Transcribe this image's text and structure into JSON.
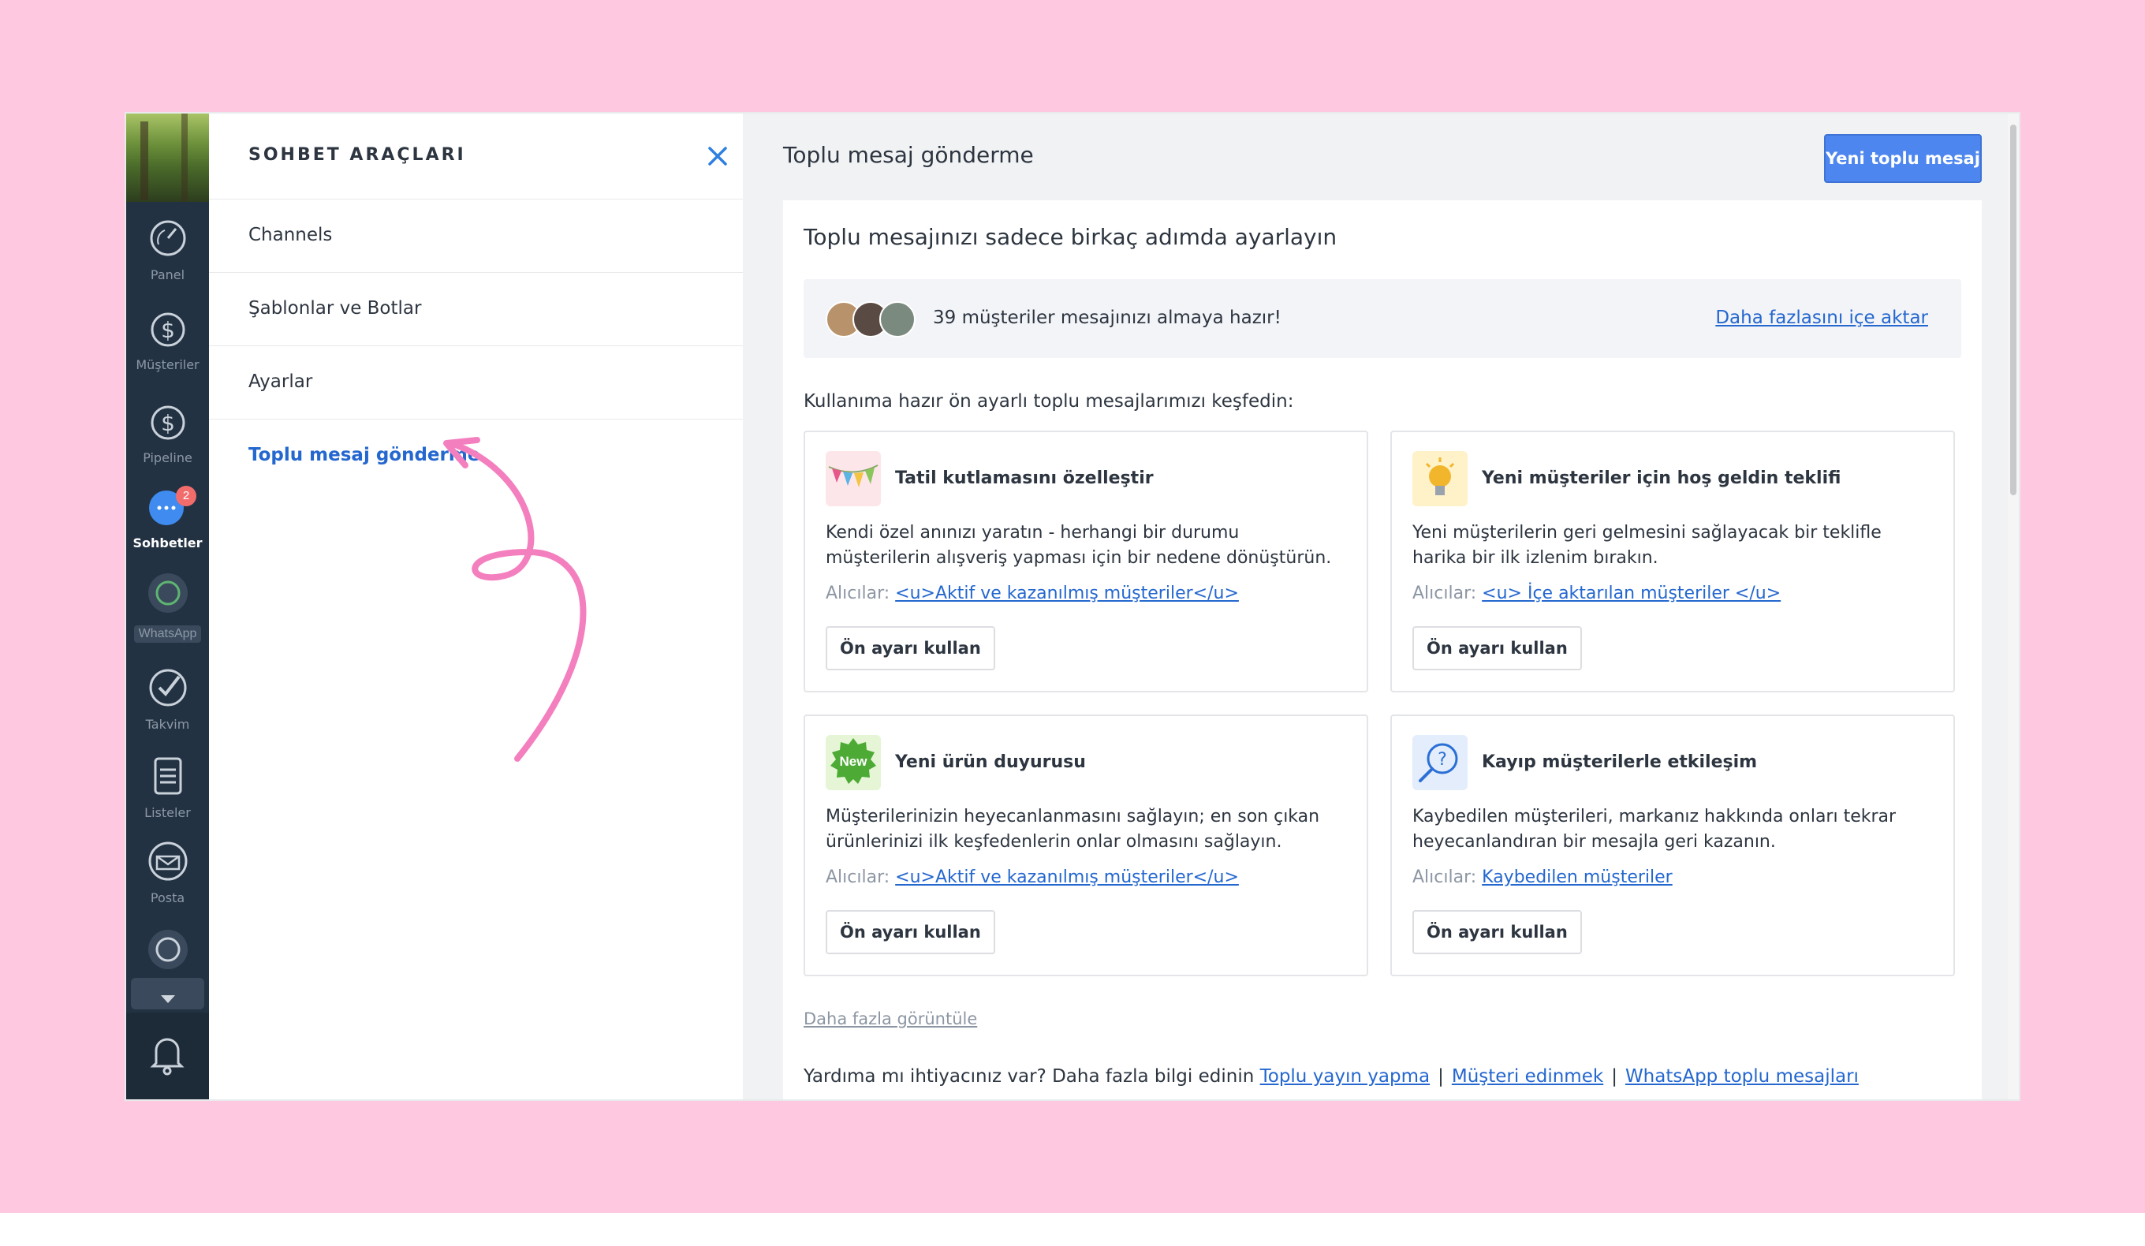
{
  "sidebar": {
    "items": [
      {
        "label": "Panel",
        "icon": "dashboard-icon"
      },
      {
        "label": "Müşteriler",
        "icon": "dollar-icon"
      },
      {
        "label": "Pipeline",
        "icon": "dollar-icon"
      },
      {
        "label": "Sohbetler",
        "icon": "chat-icon",
        "badge": "2",
        "active": true
      },
      {
        "label": "WhatsApp",
        "icon": "whatsapp-icon"
      },
      {
        "label": "Takvim",
        "icon": "check-icon"
      },
      {
        "label": "Listeler",
        "icon": "list-icon"
      },
      {
        "label": "Posta",
        "icon": "mail-icon"
      }
    ]
  },
  "tools": {
    "title": "SOHBET ARAÇLARI",
    "items": [
      "Channels",
      "Şablonlar ve Botlar",
      "Ayarlar",
      "Toplu mesaj gönderme"
    ]
  },
  "main": {
    "title": "Toplu mesaj gönderme",
    "new_button": "Yeni toplu mesaj",
    "card_title": "Toplu mesajınızı sadece birkaç adımda ayarlayın",
    "ready_text": "39 müşteriler mesajınızı almaya hazır!",
    "import_link": "Daha fazlasını içe aktar",
    "explore_text": "Kullanıma hazır ön ayarlı toplu mesajlarımızı keşfedin:",
    "recipients_label": "Alıcılar:",
    "presets": [
      {
        "title": "Tatil kutlamasını özelleştir",
        "desc": "Kendi özel anınızı yaratın - herhangi bir durumu müşterilerin alışveriş yapması için bir nedene dönüştürün.",
        "recipients": "<u>Aktif ve kazanılmış müşteriler</u>",
        "button": "Ön ayarı kullan",
        "icon": "party-flags-icon"
      },
      {
        "title": "Yeni müşteriler için hoş geldin teklifi",
        "desc": "Yeni müşterilerin geri gelmesini sağlayacak bir teklifle harika bir ilk izlenim bırakın.",
        "recipients": "<u> İçe aktarılan müşteriler </u>",
        "button": "Ön ayarı kullan",
        "icon": "lightbulb-icon"
      },
      {
        "title": "Yeni ürün duyurusu",
        "desc": "Müşterilerinizin heyecanlanmasını sağlayın; en son çıkan ürünlerinizi ilk keşfedenlerin onlar olmasını sağlayın.",
        "recipients": "<u>Aktif ve kazanılmış müşteriler</u>",
        "button": "Ön ayarı kullan",
        "icon": "new-badge-icon",
        "icon_text": "New"
      },
      {
        "title": "Kayıp müşterilerle etkileşim",
        "desc": "Kaybedilen müşterileri, markanız hakkında onları tekrar heyecanlandıran bir mesajla geri kazanın.",
        "recipients": "Kaybedilen müşteriler",
        "button": "Ön ayarı kullan",
        "icon": "question-search-icon"
      }
    ],
    "more_link": "Daha fazla görüntüle",
    "help_text": "Yardıma mı ihtiyacınız var? Daha fazla bilgi edinin",
    "help_links": [
      "Toplu yayın yapma",
      "Müşteri edinmek",
      "WhatsApp toplu mesajları"
    ],
    "help_sep": "|"
  },
  "colors": {
    "background": "#ffc8e1",
    "accent": "#4d86ee",
    "link": "#2467cf",
    "sidebar": "#233242",
    "arrow": "#f47fbf"
  }
}
